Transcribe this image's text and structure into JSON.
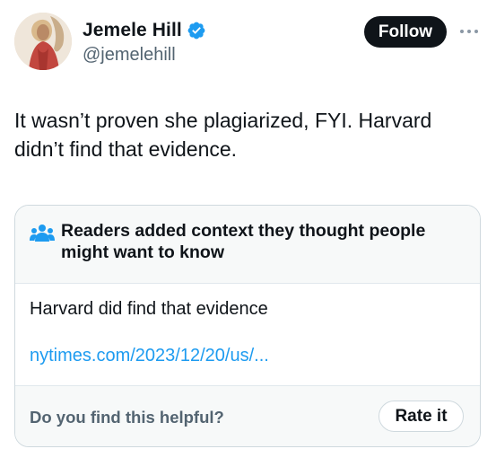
{
  "author": {
    "display_name": "Jemele Hill",
    "handle": "@jemelehill",
    "verified_icon": "verified-badge-icon",
    "avatar_icon": "profile-photo"
  },
  "actions": {
    "follow_label": "Follow",
    "more_icon": "more-options-icon"
  },
  "tweet": {
    "text": "It wasn’t proven she plagiarized, FYI. Harvard didn’t find that evidence."
  },
  "community_note": {
    "header_icon": "people-icon",
    "title": "Readers added context they thought people might want to know",
    "body": "Harvard did find that evidence",
    "link_text": "nytimes.com/2023/12/20/us/...",
    "question": "Do you find this helpful?",
    "rate_label": "Rate it"
  },
  "colors": {
    "accent": "#1d9bf0",
    "text_primary": "#0f1419",
    "text_secondary": "#536471",
    "note_background": "#f7f9f9"
  }
}
